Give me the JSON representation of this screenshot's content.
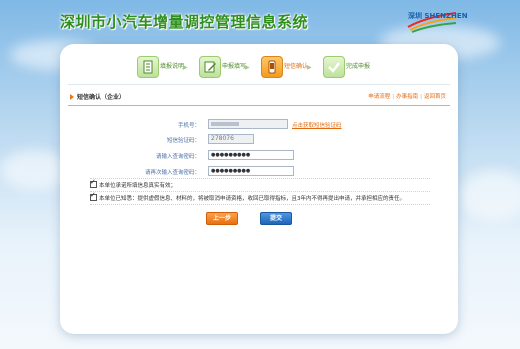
{
  "header": {
    "site_title": "深圳市小汽车增量调控管理信息系统",
    "logo_text": "深圳 SHENZHEN"
  },
  "steps": [
    {
      "label": "填报说明",
      "icon": "document-icon",
      "active": false
    },
    {
      "label": "申报填写",
      "icon": "edit-icon",
      "active": false
    },
    {
      "label": "短信确认",
      "icon": "phone-icon",
      "active": true
    },
    {
      "label": "完成申报",
      "icon": "check-icon",
      "active": false
    }
  ],
  "section": {
    "title": "短信确认（企业）",
    "links": [
      "申请流程",
      "办事指南",
      "返回首页"
    ]
  },
  "form": {
    "phone_label": "手机号：",
    "phone_value": "",
    "get_code_link": "点击获取短信验证码",
    "sms_code_label": "短信验证码：",
    "sms_code_value": "278076",
    "query_pw_label": "请输入查询密码：",
    "query_pw_value": "●●●●●●●●●",
    "query_pw_confirm_label": "请再次输入查询密码：",
    "query_pw_confirm_value": "●●●●●●●●●"
  },
  "declarations": [
    "本单位承诺所填信息真实有效；",
    "本单位已知悉：提供虚假信息、材料的，将被取消申请资格，收回已取得指标，且3年内不得再提出申请，并承担相应的责任。"
  ],
  "buttons": {
    "prev": "上一步",
    "submit": "提交"
  },
  "colors": {
    "title_green": "#2f8f1e",
    "accent_orange": "#e06a10",
    "submit_blue": "#1f66b8"
  }
}
